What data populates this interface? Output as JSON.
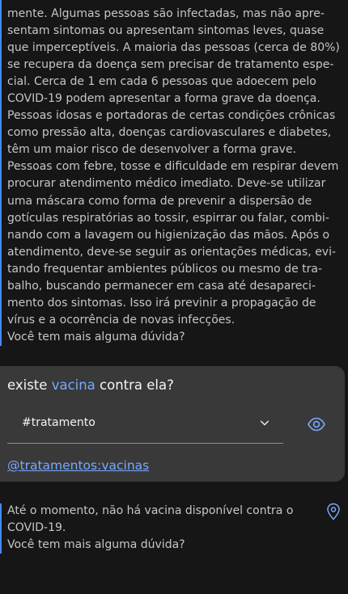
{
  "bot_response_1": {
    "lines": [
      "mente. Algumas pessoas são infectadas, mas não apre-",
      "sentam sintomas ou apresentam sintomas leves, quase",
      "que imperceptíveis. A maioria das pessoas (cerca de 80%)",
      "se recupera da doença sem precisar de tratamento espe-",
      "cial. Cerca de 1 em cada 6 pessoas que adoecem pelo",
      "COVID-19 podem apresentar a forma grave da doença.",
      "Pessoas idosas e portadoras de certas condições crônicas",
      "como pressão alta, doenças cardiovasculares e diabetes,",
      "têm um maior risco de desenvolver a forma grave.",
      "Pessoas com febre, tosse e dificuldade em respirar devem",
      "procurar atendimento médico imediato. Deve-se utilizar",
      "uma máscara como forma de prevenir a dispersão de",
      "gotículas respiratórias ao tossir, espirrar ou falar, combi-",
      "nando com a lavagem ou higienização das mãos. Após o",
      "atendimento, deve-se seguir as orientações médicas, evi-",
      "tando frequentar ambientes públicos ou mesmo de tra-",
      "balho, buscando permanecer em casa até desapareci-",
      "mento dos sintomas. Isso irá previnir a propagação de",
      "vírus e a ocorrência de novas infecções.",
      "Você tem mais alguma dúvida?"
    ]
  },
  "user_message": {
    "prefix": "existe ",
    "entity": "vacina",
    "suffix": " contra ela?",
    "intent_selected": "#tratamento",
    "entity_link": "@tratamentos:vacinas"
  },
  "bot_response_2": {
    "lines": [
      "Até o momento, não há vacina disponível contra o",
      "COVID-19.",
      "Você tem mais alguma dúvida?"
    ]
  },
  "colors": {
    "background": "#161616",
    "card": "#393939",
    "accent": "#4589ff",
    "link": "#78a9ff"
  },
  "icons": {
    "intent_dropdown": "chevron-down-icon",
    "view": "eye-icon",
    "pin": "location-pin-icon"
  }
}
